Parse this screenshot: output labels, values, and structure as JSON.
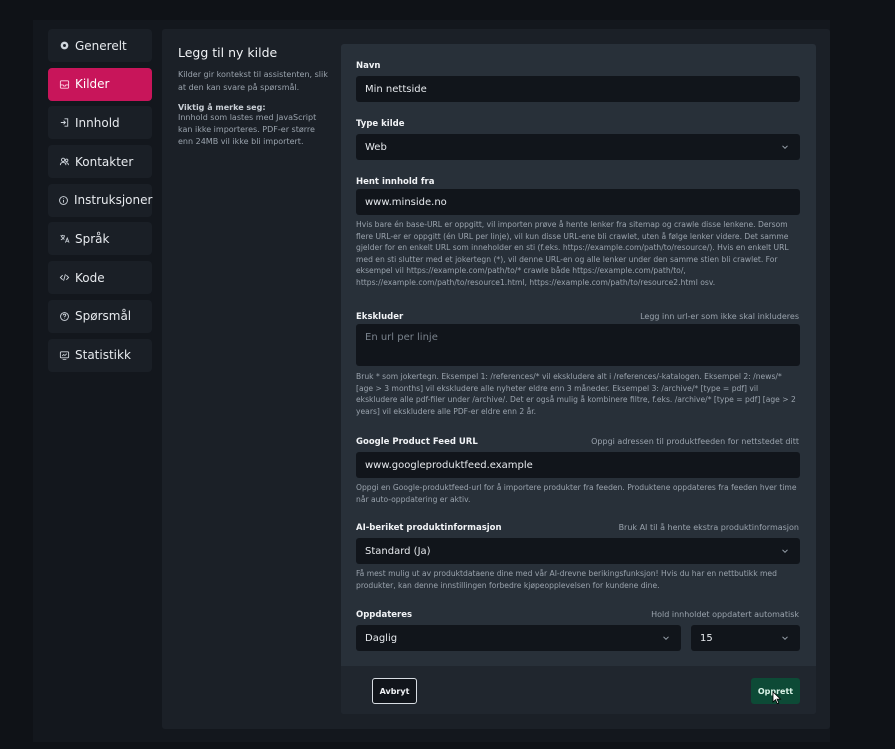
{
  "sidebar": {
    "items": [
      {
        "label": "Generelt",
        "icon": "gear-icon"
      },
      {
        "label": "Kilder",
        "icon": "inbox-icon"
      },
      {
        "label": "Innhold",
        "icon": "login-icon"
      },
      {
        "label": "Kontakter",
        "icon": "users-icon"
      },
      {
        "label": "Instruksjoner",
        "icon": "info-icon"
      },
      {
        "label": "Språk",
        "icon": "translate-icon"
      },
      {
        "label": "Kode",
        "icon": "code-icon"
      },
      {
        "label": "Spørsmål",
        "icon": "question-icon"
      },
      {
        "label": "Statistikk",
        "icon": "chart-icon"
      }
    ],
    "active_index": 1
  },
  "info": {
    "title": "Legg til ny kilde",
    "description": "Kilder gir kontekst til assistenten, slik at den kan svare på spørsmål.",
    "note_title": "Viktig å merke seg:",
    "note": "Innhold som lastes med JavaScript kan ikke importeres. PDF-er større enn 24MB vil ikke bli importert."
  },
  "form": {
    "name": {
      "label": "Navn",
      "value": "Min nettside"
    },
    "source_type": {
      "label": "Type kilde",
      "value": "Web"
    },
    "fetch_from": {
      "label": "Hent innhold fra",
      "value": "www.minside.no",
      "help": "Hvis bare én base-URL er oppgitt, vil importen prøve å hente lenker fra sitemap og crawle disse lenkene. Dersom flere URL-er er oppgitt (én URL per linje), vil kun disse URL-ene bli crawlet, uten å følge lenker videre. Det samme gjelder for en enkelt URL som inneholder en sti (f.eks. https://example.com/path/to/resource/). Hvis en enkelt URL med en sti slutter med et jokertegn (*), vil denne URL-en og alle lenker under den samme stien bli crawlet. For eksempel vil https://example.com/path/to/* crawle både https://example.com/path/to/, https://example.com/path/to/resource1.html, https://example.com/path/to/resource2.html osv."
    },
    "exclude": {
      "label": "Ekskluder",
      "hint": "Legg inn url-er som ikke skal inkluderes",
      "placeholder": "En url per linje",
      "help": "Bruk * som jokertegn. Eksempel 1: /references/* vil ekskludere alt i /references/-katalogen. Eksempel 2: /news/* [age > 3 months] vil ekskludere alle nyheter eldre enn 3 måneder. Eksempel 3: /archive/* [type = pdf] vil ekskludere alle pdf-filer under /archive/. Det er også mulig å kombinere filtre, f.eks. /archive/* [type = pdf] [age > 2 years] vil ekskludere alle PDF-er eldre enn 2 år."
    },
    "product_feed": {
      "label": "Google Product Feed URL",
      "hint": "Oppgi adressen til produktfeeden for nettstedet ditt",
      "value": "www.googleproduktfeed.example",
      "help": "Oppgi en Google-produktfeed-url for å importere produkter fra feeden. Produktene oppdateres fra feeden hver time når auto-oppdatering er aktiv."
    },
    "ai_enriched": {
      "label": "AI-beriket produktinformasjon",
      "hint": "Bruk AI til å hente ekstra produktinformasjon",
      "value": "Standard (Ja)",
      "help": "Få mest mulig ut av produktdataene dine med vår AI-drevne berikingsfunksjon! Hvis du har en nettbutikk med produkter, kan denne innstillingen forbedre kjøpeopplevelsen for kundene dine."
    },
    "update": {
      "label": "Oppdateres",
      "hint": "Hold innholdet oppdatert automatisk",
      "frequency": "Daglig",
      "amount": "15"
    }
  },
  "buttons": {
    "cancel": "Avbryt",
    "create": "Opprett"
  }
}
